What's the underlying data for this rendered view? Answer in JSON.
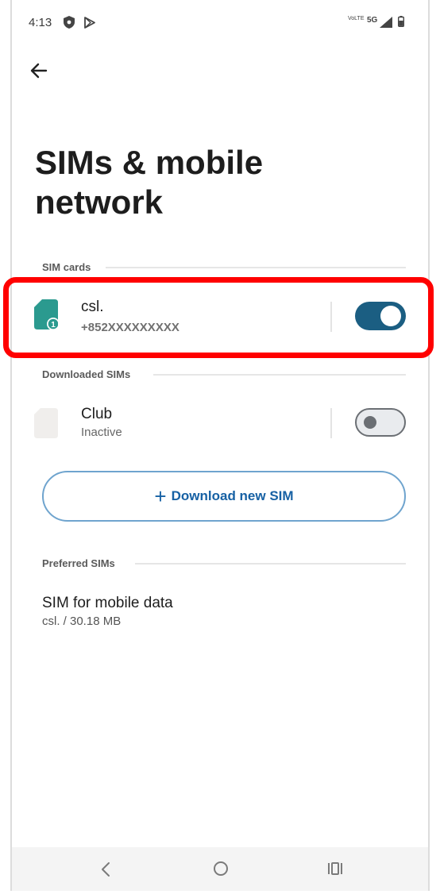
{
  "status_bar": {
    "time": "4:13",
    "volte_label": "VoLTE",
    "network_label": "5G",
    "icons": [
      "shield-icon",
      "play-store-icon",
      "volte-icon",
      "signal-icon",
      "battery-icon"
    ]
  },
  "header": {
    "back_icon": "arrow-left-icon",
    "title": "SIMs & mobile network"
  },
  "sections": {
    "sim_cards": "SIM cards",
    "downloaded_sims": "Downloaded SIMs",
    "preferred_sims": "Preferred SIMs"
  },
  "sim_cards": [
    {
      "name": "csl.",
      "number": "+852XXXXXXXXX",
      "slot_badge": "1",
      "enabled": true,
      "highlighted": true
    }
  ],
  "downloaded_sims": [
    {
      "name": "Club",
      "status": "Inactive",
      "enabled": false
    }
  ],
  "download_button": {
    "label": "Download new SIM",
    "icon": "plus-icon"
  },
  "preferred": {
    "mobile_data_title": "SIM for mobile data",
    "mobile_data_value": "csl. / 30.18 MB"
  },
  "navigation": {
    "icons": [
      "back-nav-icon",
      "home-nav-icon",
      "recents-nav-icon"
    ]
  },
  "colors": {
    "toggle_on": "#1b5e82",
    "toggle_off_track": "#e9ebee",
    "sim_icon_active": "#2b9a8f",
    "highlight": "#ff0000",
    "link_blue": "#1761a4"
  }
}
